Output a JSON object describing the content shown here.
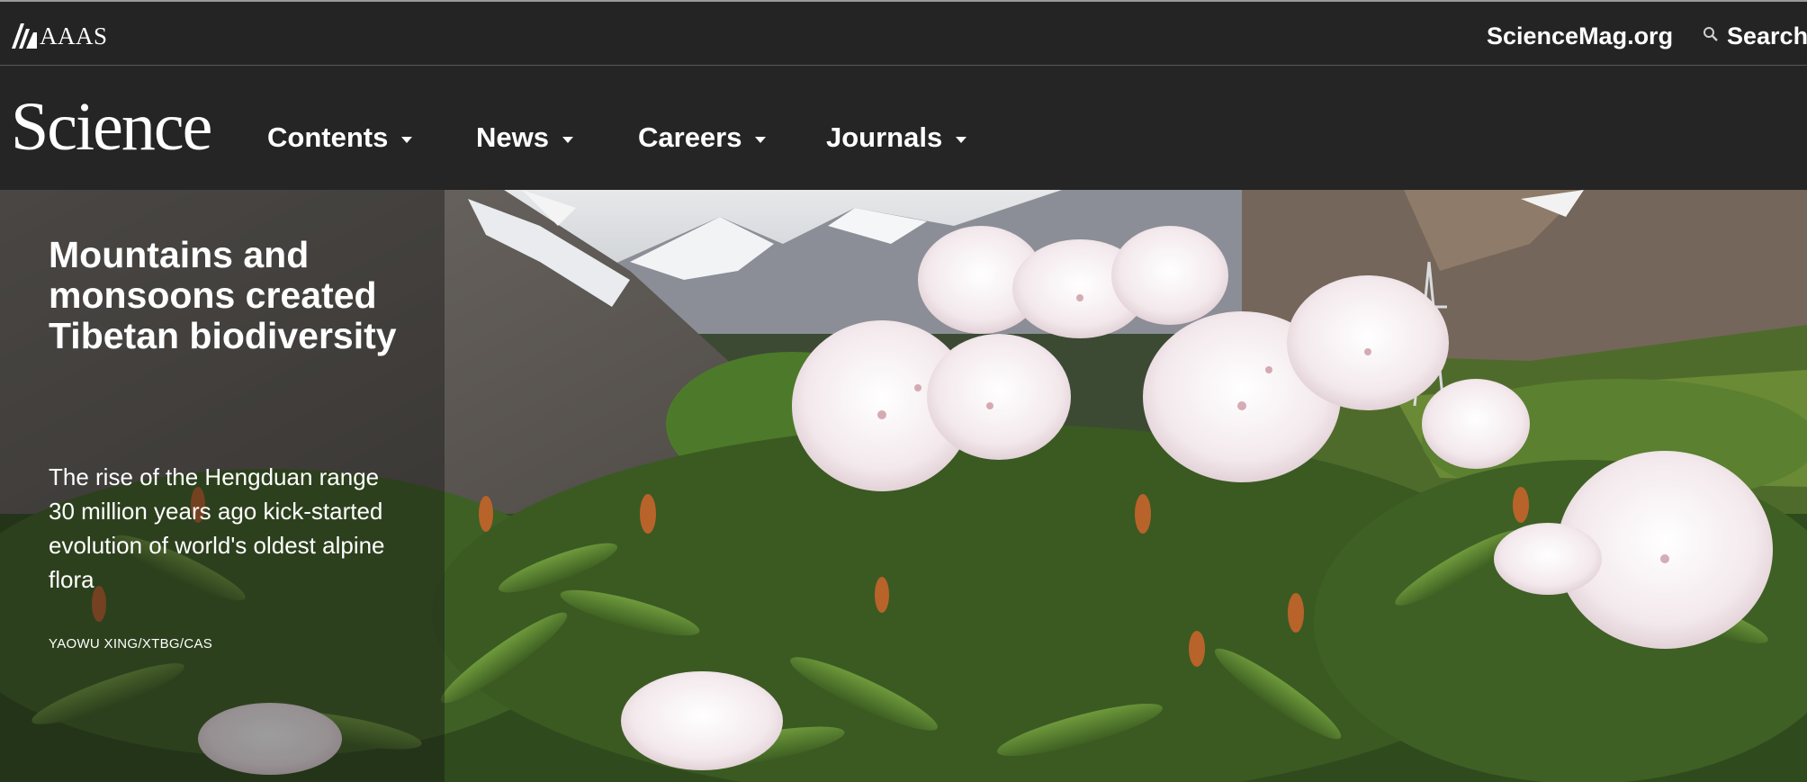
{
  "header": {
    "org_name": "AAAS",
    "site_link": "ScienceMag.org",
    "search_label": "Search"
  },
  "nav": {
    "logo": "Science",
    "items": [
      {
        "label": "Contents"
      },
      {
        "label": "News"
      },
      {
        "label": "Careers"
      },
      {
        "label": "Journals"
      }
    ]
  },
  "hero": {
    "title": "Mountains and monsoons created Tibetan biodiversity",
    "summary": "The rise of the Hengduan range 30 million years ago kick-started evolution of world's oldest alpine flora",
    "credit": "YAOWU XING/XTBG/CAS"
  },
  "colors": {
    "header_bg": "#242424",
    "nav_bg": "#252525",
    "text": "#ffffff"
  },
  "icons": [
    "aaas-logo-icon",
    "search-icon",
    "chevron-down-icon"
  ]
}
